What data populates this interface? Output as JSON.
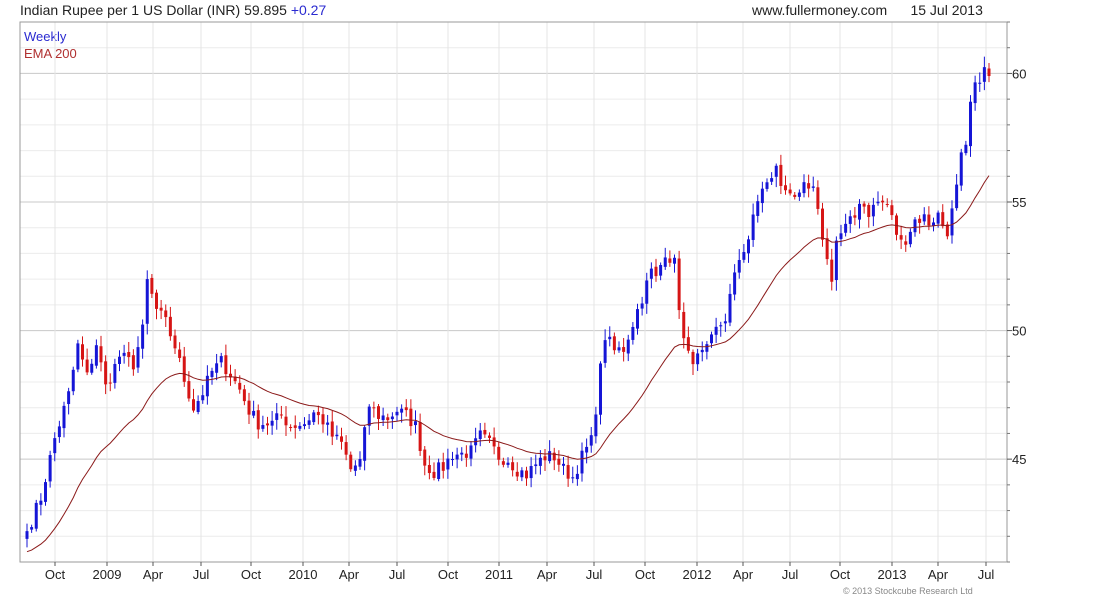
{
  "header": {
    "title": "Indian Rupee per 1 US Dollar (INR)",
    "last_value": "59.895",
    "change": "+0.27",
    "website": "www.fullermoney.com",
    "date": "15 Jul 2013"
  },
  "footer": {
    "copyright": "© 2013 Stockcube Research Ltd"
  },
  "chart_data": {
    "type": "candlestick",
    "period": "Weekly",
    "ylim": [
      41.0,
      62.0
    ],
    "y_ticks": [
      45,
      50,
      55,
      60
    ],
    "x_ticks": [
      "Oct",
      "2009",
      "Apr",
      "Jul",
      "Oct",
      "2010",
      "Apr",
      "Jul",
      "Oct",
      "2011",
      "Apr",
      "Jul",
      "Oct",
      "2012",
      "Apr",
      "Jul",
      "Oct",
      "2013",
      "Apr",
      "Jul"
    ],
    "grid": true,
    "legend": [
      "Weekly",
      "EMA 200"
    ],
    "colors": {
      "up": "#1515d6",
      "down": "#d61515",
      "ema": "#8b1a1a",
      "grid": "#dcdcdc"
    },
    "close_anchors": [
      [
        0,
        42.2
      ],
      [
        3,
        43.5
      ],
      [
        6,
        45.8
      ],
      [
        9,
        47.5
      ],
      [
        11,
        49.4
      ],
      [
        13,
        48.2
      ],
      [
        15,
        49.5
      ],
      [
        17,
        47.8
      ],
      [
        20,
        49.0
      ],
      [
        23,
        48.7
      ],
      [
        25,
        50.0
      ],
      [
        26,
        51.9
      ],
      [
        28,
        50.8
      ],
      [
        30,
        50.3
      ],
      [
        32,
        49.4
      ],
      [
        34,
        48.1
      ],
      [
        36,
        47.0
      ],
      [
        38,
        47.6
      ],
      [
        40,
        48.4
      ],
      [
        42,
        48.8
      ],
      [
        44,
        48.3
      ],
      [
        46,
        47.7
      ],
      [
        48,
        46.9
      ],
      [
        50,
        46.4
      ],
      [
        53,
        46.4
      ],
      [
        55,
        46.7
      ],
      [
        57,
        46.3
      ],
      [
        60,
        46.4
      ],
      [
        62,
        46.8
      ],
      [
        64,
        46.5
      ],
      [
        66,
        45.9
      ],
      [
        68,
        45.6
      ],
      [
        70,
        44.6
      ],
      [
        72,
        44.9
      ],
      [
        73,
        46.0
      ],
      [
        74,
        47.1
      ],
      [
        76,
        46.7
      ],
      [
        78,
        46.6
      ],
      [
        80,
        46.9
      ],
      [
        82,
        46.7
      ],
      [
        84,
        46.3
      ],
      [
        86,
        44.8
      ],
      [
        88,
        44.5
      ],
      [
        90,
        44.7
      ],
      [
        92,
        45.2
      ],
      [
        94,
        45.2
      ],
      [
        96,
        45.3
      ],
      [
        97,
        45.6
      ],
      [
        98,
        45.9
      ],
      [
        100,
        45.6
      ],
      [
        102,
        45.1
      ],
      [
        104,
        45.0
      ],
      [
        106,
        44.6
      ],
      [
        108,
        44.4
      ],
      [
        110,
        44.8
      ],
      [
        112,
        45.1
      ],
      [
        114,
        45.1
      ],
      [
        116,
        44.6
      ],
      [
        118,
        44.3
      ],
      [
        120,
        45.1
      ],
      [
        122,
        45.7
      ],
      [
        123,
        47.0
      ],
      [
        124,
        48.5
      ],
      [
        125,
        49.8
      ],
      [
        127,
        49.2
      ],
      [
        129,
        49.3
      ],
      [
        131,
        50.3
      ],
      [
        133,
        51.3
      ],
      [
        135,
        52.3
      ],
      [
        136,
        52.0
      ],
      [
        138,
        53.1
      ],
      [
        140,
        52.6
      ],
      [
        141,
        51.0
      ],
      [
        142,
        49.6
      ],
      [
        143,
        49.0
      ],
      [
        145,
        48.9
      ],
      [
        147,
        49.2
      ],
      [
        149,
        50.0
      ],
      [
        151,
        50.5
      ],
      [
        152,
        51.3
      ],
      [
        154,
        52.8
      ],
      [
        156,
        53.6
      ],
      [
        158,
        55.0
      ],
      [
        159,
        55.6
      ],
      [
        161,
        55.8
      ],
      [
        162,
        56.5
      ],
      [
        163,
        55.5
      ],
      [
        165,
        55.5
      ],
      [
        167,
        55.1
      ],
      [
        168,
        55.5
      ],
      [
        170,
        55.4
      ],
      [
        171,
        54.5
      ],
      [
        172,
        53.7
      ],
      [
        173,
        52.7
      ],
      [
        174,
        52.1
      ],
      [
        175,
        53.5
      ],
      [
        177,
        54.0
      ],
      [
        179,
        54.4
      ],
      [
        180,
        55.1
      ],
      [
        182,
        54.6
      ],
      [
        184,
        55.0
      ],
      [
        186,
        54.9
      ],
      [
        188,
        53.8
      ],
      [
        189,
        53.4
      ],
      [
        190,
        53.6
      ],
      [
        192,
        54.3
      ],
      [
        194,
        54.4
      ],
      [
        195,
        54.2
      ],
      [
        197,
        54.5
      ],
      [
        198,
        54.1
      ],
      [
        199,
        53.9
      ],
      [
        200,
        54.6
      ],
      [
        201,
        55.5
      ],
      [
        202,
        56.7
      ],
      [
        203,
        57.0
      ],
      [
        204,
        58.8
      ],
      [
        205,
        59.4
      ],
      [
        206,
        59.9
      ],
      [
        207,
        60.1
      ],
      [
        208,
        59.9
      ]
    ]
  }
}
